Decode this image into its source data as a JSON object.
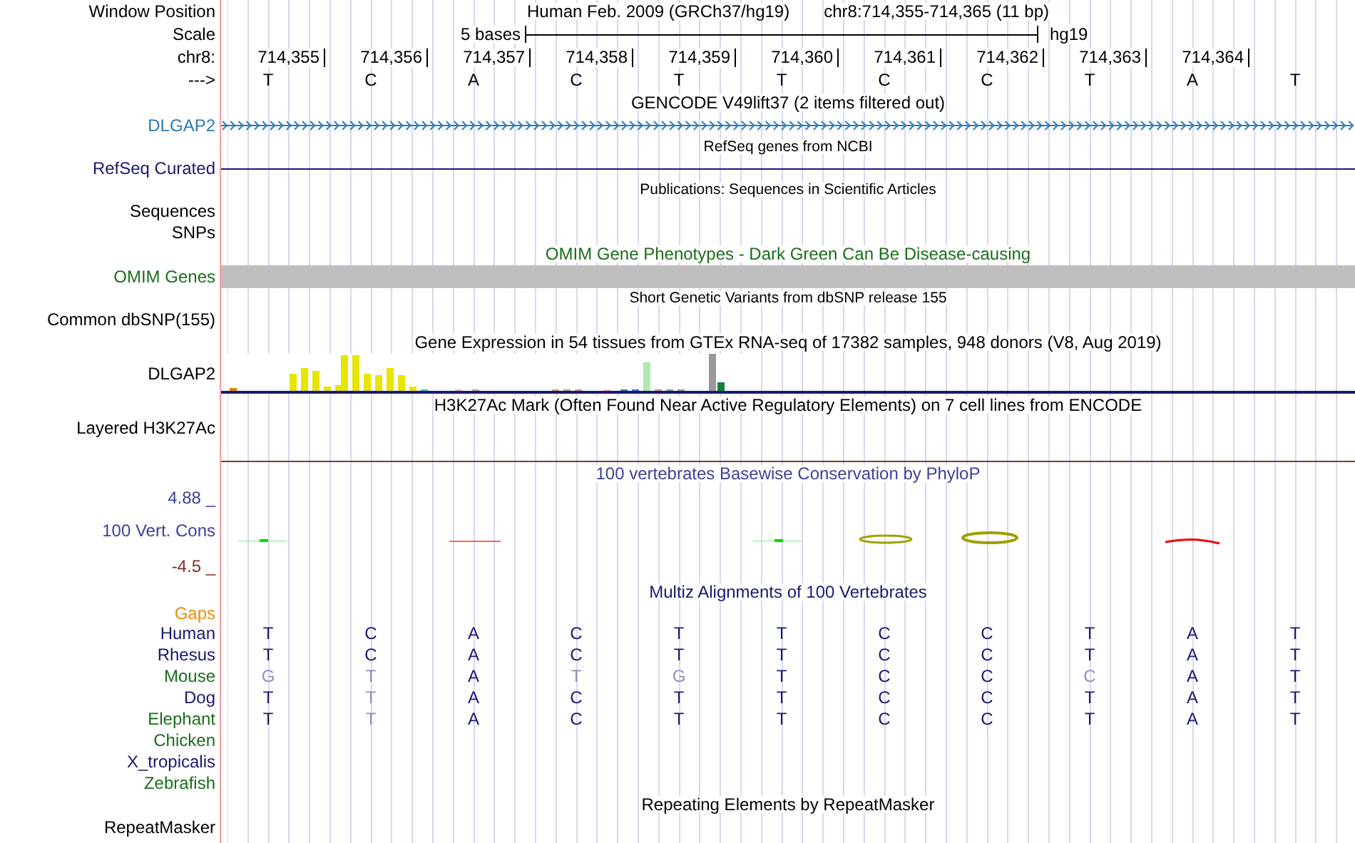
{
  "header": {
    "window_label": "Window Position",
    "assembly": "Human Feb. 2009 (GRCh37/hg19)",
    "position": "chr8:714,355-714,365 (11 bp)",
    "scale_label": "Scale",
    "scale_size": "5 bases",
    "scale_db": "hg19",
    "chrom_label": "chr8:",
    "ticks": [
      "714,355",
      "714,356",
      "714,357",
      "714,358",
      "714,359",
      "714,360",
      "714,361",
      "714,362",
      "714,363",
      "714,364"
    ],
    "strand_label": "--->",
    "bases": [
      "T",
      "C",
      "A",
      "C",
      "T",
      "T",
      "C",
      "C",
      "T",
      "A",
      "T"
    ]
  },
  "tracks": [
    {
      "kind": "gene",
      "title": "GENCODE V49lift37 (2 items filtered out)",
      "label": "DLGAP2"
    },
    {
      "kind": "line",
      "title": "RefSeq genes from NCBI",
      "label": "RefSeq Curated"
    },
    {
      "kind": "publications",
      "title": "Publications: Sequences in Scientific Articles",
      "labels": [
        "Sequences",
        "SNPs"
      ]
    },
    {
      "kind": "omim",
      "title": "OMIM Gene Phenotypes - Dark Green Can Be Disease-causing",
      "label": "OMIM Genes"
    },
    {
      "kind": "variants",
      "title": "Short Genetic Variants from dbSNP release 155",
      "label": "Common dbSNP(155)"
    },
    {
      "kind": "expression",
      "title": "Gene Expression in 54 tissues from GTEx RNA-seq of 17382 samples, 948 donors (V8, Aug 2019)",
      "label": "DLGAP2"
    },
    {
      "kind": "h3k27",
      "title": "H3K27Ac Mark (Often Found Near Active Regulatory Elements) on 7 cell lines from ENCODE",
      "label": "Layered H3K27Ac"
    },
    {
      "kind": "conservation",
      "title": "100 vertebrates Basewise Conservation by PhyloP",
      "label": "100 Vert. Cons",
      "max": "4.88 _",
      "min": "-4.5 _"
    },
    {
      "kind": "alignment",
      "title": "Multiz Alignments of 100 Vertebrates",
      "gaps_label": "Gaps",
      "species": [
        {
          "name": "Human",
          "color": "#191970",
          "bases": [
            "T",
            "C",
            "A",
            "C",
            "T",
            "T",
            "C",
            "C",
            "T",
            "A",
            "T"
          ],
          "faded": [
            false,
            false,
            false,
            false,
            false,
            false,
            false,
            false,
            false,
            false,
            false
          ]
        },
        {
          "name": "Rhesus",
          "color": "#191970",
          "bases": [
            "T",
            "C",
            "A",
            "C",
            "T",
            "T",
            "C",
            "C",
            "T",
            "A",
            "T"
          ],
          "faded": [
            false,
            false,
            false,
            false,
            false,
            false,
            false,
            false,
            false,
            false,
            false
          ]
        },
        {
          "name": "Mouse",
          "color": "#1a6e1a",
          "bases": [
            "G",
            "T",
            "A",
            "T",
            "G",
            "T",
            "C",
            "C",
            "C",
            "A",
            "T"
          ],
          "faded": [
            true,
            true,
            false,
            true,
            true,
            false,
            false,
            false,
            true,
            false,
            false
          ]
        },
        {
          "name": "Dog",
          "color": "#191970",
          "bases": [
            "T",
            "T",
            "A",
            "C",
            "T",
            "T",
            "C",
            "C",
            "T",
            "A",
            "T"
          ],
          "faded": [
            false,
            true,
            false,
            false,
            false,
            false,
            false,
            false,
            false,
            false,
            false
          ]
        },
        {
          "name": "Elephant",
          "color": "#1a6e1a",
          "bases": [
            "T",
            "T",
            "A",
            "C",
            "T",
            "T",
            "C",
            "C",
            "T",
            "A",
            "T"
          ],
          "faded": [
            false,
            true,
            false,
            false,
            false,
            false,
            false,
            false,
            false,
            false,
            false
          ]
        },
        {
          "name": "Chicken",
          "color": "#1a6e1a"
        },
        {
          "name": "X_tropicalis",
          "color": "#191970"
        },
        {
          "name": "Zebrafish",
          "color": "#1a6e1a"
        }
      ]
    },
    {
      "kind": "repeats",
      "title": "Repeating Elements by RepeatMasker",
      "label": "RepeatMasker"
    }
  ]
}
